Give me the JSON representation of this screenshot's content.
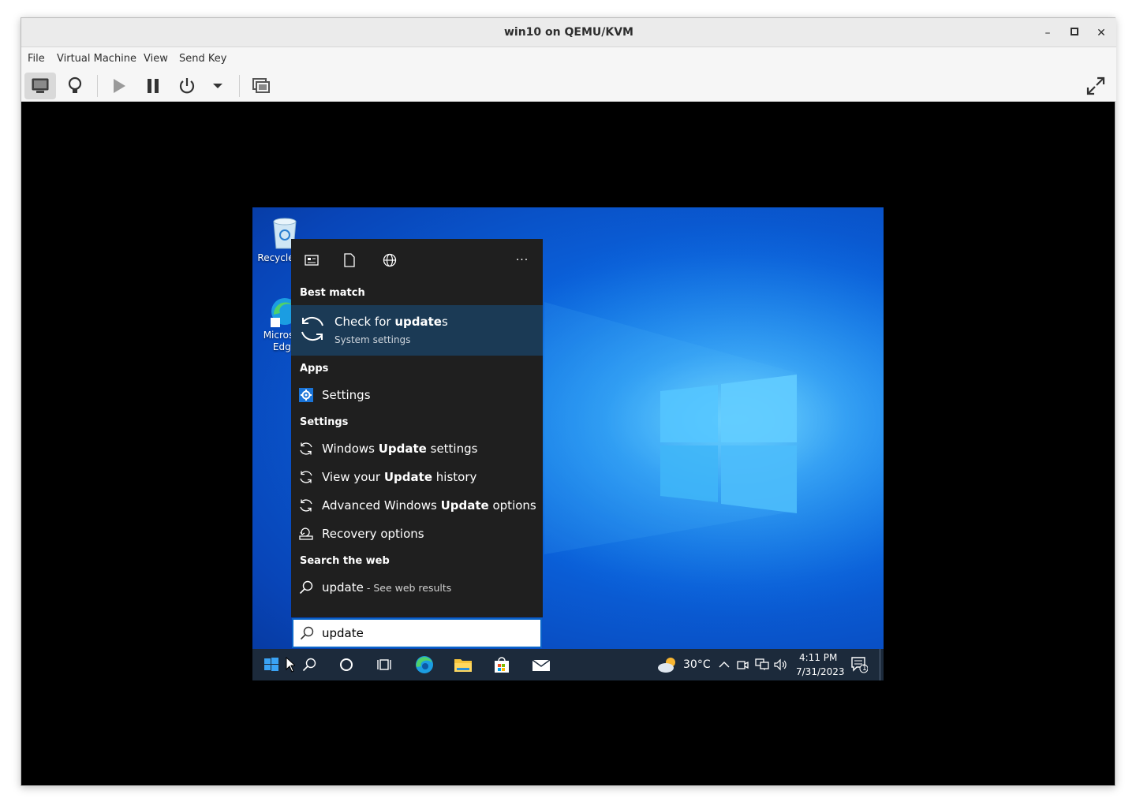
{
  "window": {
    "title": "win10 on QEMU/KVM",
    "minimize_label": "–",
    "maximize_label": "□",
    "close_label": "✕"
  },
  "menubar": {
    "items": [
      "File",
      "Virtual Machine",
      "View",
      "Send Key"
    ]
  },
  "toolbar": {
    "buttons": [
      "console-icon",
      "details-bulb-icon",
      "run-icon",
      "pause-icon",
      "power-icon",
      "power-dropdown-icon",
      "snapshots-icon",
      "fullscreen-icon"
    ]
  },
  "desktop": {
    "icons": [
      {
        "label": "Recycle Bin",
        "icon": "recycle-bin-icon"
      },
      {
        "label": "Microsoft Edge",
        "icon": "edge-icon"
      }
    ]
  },
  "search_panel": {
    "top_icons": [
      "apps-filter-icon",
      "documents-filter-icon",
      "web-filter-icon",
      "more-options-icon"
    ],
    "more_label": "···",
    "best_match_header": "Best match",
    "best_match": {
      "title_prefix": "Check for ",
      "title_bold": "update",
      "title_suffix": "s",
      "subtitle": "System settings"
    },
    "apps_header": "Apps",
    "apps": [
      {
        "label": "Settings"
      }
    ],
    "settings_header": "Settings",
    "settings": [
      {
        "pre": "Windows ",
        "bold": "Update",
        "post": " settings"
      },
      {
        "pre": "View your ",
        "bold": "Update",
        "post": " history"
      },
      {
        "pre": "Advanced Windows ",
        "bold": "Update",
        "post": " options"
      },
      {
        "pre": "Recovery options",
        "bold": "",
        "post": ""
      }
    ],
    "web_header": "Search the web",
    "web_result": {
      "query": "update",
      "suffix": " - See web results"
    }
  },
  "search_box": {
    "value": "update"
  },
  "taskbar": {
    "weather_temp": "30°C",
    "time": "4:11 PM",
    "date": "7/31/2023",
    "notification_count": "1"
  }
}
